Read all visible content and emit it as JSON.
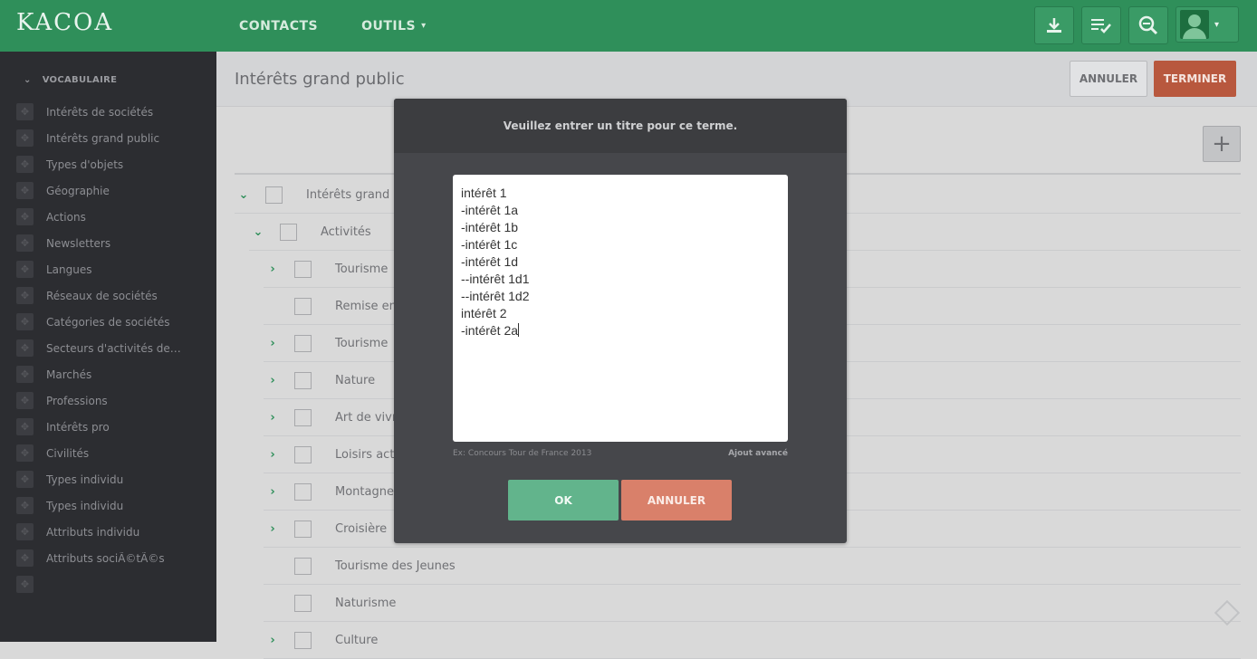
{
  "app": {
    "logo_text": "KACOA"
  },
  "topnav": {
    "items": [
      {
        "label": "CONTACTS"
      },
      {
        "label": "OUTILS"
      }
    ],
    "icons": [
      "download-icon",
      "checklist-icon",
      "search-zoom-icon",
      "user-avatar"
    ]
  },
  "sidebar": {
    "header": "VOCABULAIRE",
    "items": [
      {
        "label": "Intérêts de sociétés"
      },
      {
        "label": "Intérêts grand public"
      },
      {
        "label": "Types d'objets"
      },
      {
        "label": "Géographie"
      },
      {
        "label": "Actions"
      },
      {
        "label": "Newsletters"
      },
      {
        "label": "Langues"
      },
      {
        "label": "Réseaux de sociétés"
      },
      {
        "label": "Catégories de sociétés"
      },
      {
        "label": "Secteurs d'activités de so.."
      },
      {
        "label": "Marchés"
      },
      {
        "label": "Professions"
      },
      {
        "label": "Intérêts pro"
      },
      {
        "label": "Civilités"
      },
      {
        "label": "Types individu"
      },
      {
        "label": "Types individu"
      },
      {
        "label": "Attributs individu"
      },
      {
        "label": "Attributs sociÃ©tÃ©s"
      },
      {
        "label": ""
      }
    ]
  },
  "header": {
    "title": "Intérêts grand public",
    "cancel_label": "ANNULER",
    "finish_label": "TERMINER"
  },
  "tree": {
    "root": {
      "label": "Intérêts grand p"
    },
    "group": {
      "label": "Activités"
    },
    "items": [
      {
        "label": "Tourisme",
        "expandable": true
      },
      {
        "label": "Remise en",
        "expandable": false
      },
      {
        "label": "Tourisme",
        "expandable": true
      },
      {
        "label": "Nature",
        "expandable": true
      },
      {
        "label": "Art de vivr",
        "expandable": true
      },
      {
        "label": "Loisirs act",
        "expandable": true
      },
      {
        "label": "Montagne",
        "expandable": true
      },
      {
        "label": "Croisière",
        "expandable": true
      },
      {
        "label": "Tourisme des Jeunes",
        "expandable": false
      },
      {
        "label": "Naturisme",
        "expandable": false
      },
      {
        "label": "Culture",
        "expandable": true
      }
    ]
  },
  "modal": {
    "title": "Veuillez entrer un titre pour ce terme.",
    "textarea_lines": [
      "intérêt 1",
      "-intérêt 1a",
      "-intérêt 1b",
      "-intérêt 1c",
      "-intérêt 1d",
      "--intérêt 1d1",
      "--intérêt 1d2",
      "intérêt 2",
      "-intérêt 2a"
    ],
    "hint": "Ex: Concours Tour de France 2013",
    "advanced_label": "Ajout avancé",
    "ok_label": "OK",
    "cancel_label": "ANNULER"
  },
  "colors": {
    "topbar": "#2f8f5a",
    "ok": "#62b48c",
    "cancel": "#d9806a",
    "finish": "#b8583e"
  }
}
